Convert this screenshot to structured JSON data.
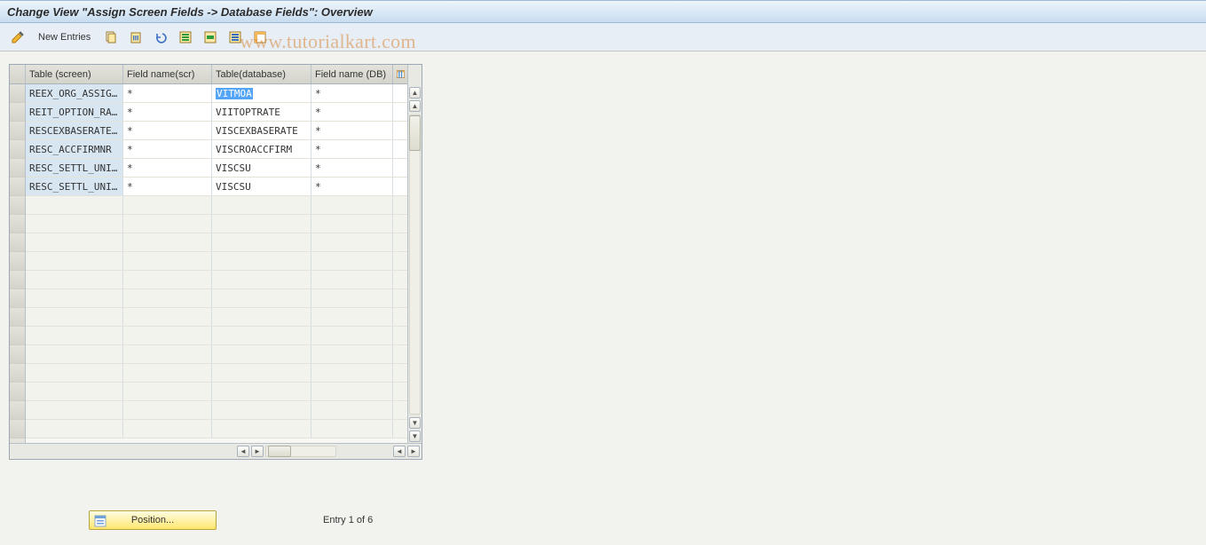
{
  "title": "Change View \"Assign Screen Fields -> Database Fields\": Overview",
  "toolbar": {
    "new_entries_label": "New Entries"
  },
  "watermark": "www.tutorialkart.com",
  "columns": {
    "c1": "Table (screen)",
    "c2": "Field name(scr)",
    "c3": "Table(database)",
    "c4": "Field name (DB)"
  },
  "rows": [
    {
      "table_screen": "REEX_ORG_ASSIG…",
      "field_scr": "*",
      "table_db": "VITMOA",
      "field_db": "*",
      "selected_db_text": true
    },
    {
      "table_screen": "REIT_OPTION_RA…",
      "field_scr": "*",
      "table_db": "VIITOPTRATE",
      "field_db": "*"
    },
    {
      "table_screen": "RESCEXBASERATE…",
      "field_scr": "*",
      "table_db": "VISCEXBASERATE",
      "field_db": "*"
    },
    {
      "table_screen": "RESC_ACCFIRMNR",
      "field_scr": "*",
      "table_db": "VISCROACCFIRM",
      "field_db": "*"
    },
    {
      "table_screen": "RESC_SETTL_UNI…",
      "field_scr": "*",
      "table_db": "VISCSU",
      "field_db": "*"
    },
    {
      "table_screen": "RESC_SETTL_UNI…",
      "field_scr": "*",
      "table_db": "VISCSU",
      "field_db": "*"
    }
  ],
  "empty_row_count": 13,
  "footer": {
    "position_label": "Position...",
    "entry_text": "Entry 1 of 6"
  }
}
